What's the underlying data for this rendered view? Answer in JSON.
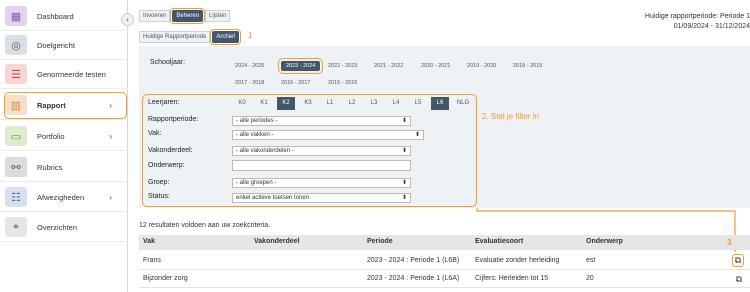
{
  "sidebar": {
    "items": [
      {
        "label": "Dashboard",
        "icon": "dashboard-icon",
        "glyph": "▦",
        "bg": "#e4d3ee",
        "fg": "#8a5aa8"
      },
      {
        "label": "Doelgericht",
        "icon": "target-icon",
        "glyph": "◎",
        "bg": "#d8e0e6",
        "fg": "#506070"
      },
      {
        "label": "Genormeerde testen",
        "icon": "list-icon",
        "glyph": "☰",
        "bg": "#f6d6d6",
        "fg": "#c05050"
      },
      {
        "label": "Rapport",
        "icon": "report-chart-icon",
        "glyph": "▥",
        "bg": "#f6dfc7",
        "fg": "#d8843a"
      },
      {
        "label": "Portfolio",
        "icon": "folder-icon",
        "glyph": "▭",
        "bg": "#dceccf",
        "fg": "#6a9a48"
      },
      {
        "label": "Rubrics",
        "icon": "share-icon",
        "glyph": "⚯",
        "bg": "#dcdcdc",
        "fg": "#555"
      },
      {
        "label": "Afwezigheden",
        "icon": "checklist-icon",
        "glyph": "☷",
        "bg": "#d7e0ee",
        "fg": "#566c92"
      },
      {
        "label": "Overzichten",
        "icon": "telescope-icon",
        "glyph": "⌖",
        "bg": "#e6e6e6",
        "fg": "#555"
      }
    ],
    "chevron": "›",
    "collapse": "‹"
  },
  "tabs": [
    "Invoeren",
    "Beheren",
    "Lijsten"
  ],
  "subtabs": [
    "Huidige Rapportperiode",
    "Archief"
  ],
  "annotations": {
    "one": "1",
    "two": "2. Stel je filter in",
    "three": "3"
  },
  "period": {
    "line1": "Huidige rapportperiode: Periode 1",
    "line2": "01/09/2024 - 31/12/2024"
  },
  "filters": {
    "schooljaar_label": "Schooljaar:",
    "years_row1": [
      "2024 - 2025",
      "2023 - 2024",
      "2022 - 2023",
      "2021 - 2022",
      "2020 - 2021",
      "2019 - 2020",
      "2018 - 2019"
    ],
    "years_row2": [
      "2017 - 2018",
      "2016 - 2017",
      "2015 - 2016"
    ],
    "leerjaren_label": "Leerjaren:",
    "grades": [
      "K0",
      "K1",
      "K2",
      "K3",
      "L1",
      "L2",
      "L3",
      "L4",
      "L5",
      "L6",
      "NLG"
    ],
    "rapportperiode_label": "Rapportperiode:",
    "rapportperiode_value": "- alle periodes -",
    "vak_label": "Vak:",
    "vak_value": "- alle vakken -",
    "vakonderdeel_label": "Vakonderdeel:",
    "vakonderdeel_value": "- alle vakonderdelen -",
    "onderwerp_label": "Onderwerp:",
    "groep_label": "Groep:",
    "groep_value": "- alle groepen -",
    "status_label": "Status:",
    "status_value": "enkel actieve toetsen tonen",
    "select_arrow": "⬍"
  },
  "results": {
    "count_text": "12 resultaten voldoen aan uw zoekcriteria.",
    "headers": [
      "Vak",
      "Vakonderdeel",
      "Periode",
      "Evaluatiesoort",
      "Onderwerp"
    ],
    "rows": [
      {
        "vak": "Frans",
        "vakonderdeel": "",
        "periode": "2023 - 2024 : Periode 1 (L6B)",
        "evaluatiesoort": "Evaluatie zonder herleiding",
        "onderwerp": "est"
      },
      {
        "vak": "Bijzonder zorg",
        "vakonderdeel": "",
        "periode": "2023 - 2024 : Periode 1 (L6A)",
        "evaluatiesoort": "Cijfers: Herleiden tot 15",
        "onderwerp": "20"
      }
    ],
    "copy_glyph": "⧉"
  },
  "colors": {
    "accent": "#f39b2d",
    "active": "#43576b",
    "panel": "#eef2f5"
  }
}
